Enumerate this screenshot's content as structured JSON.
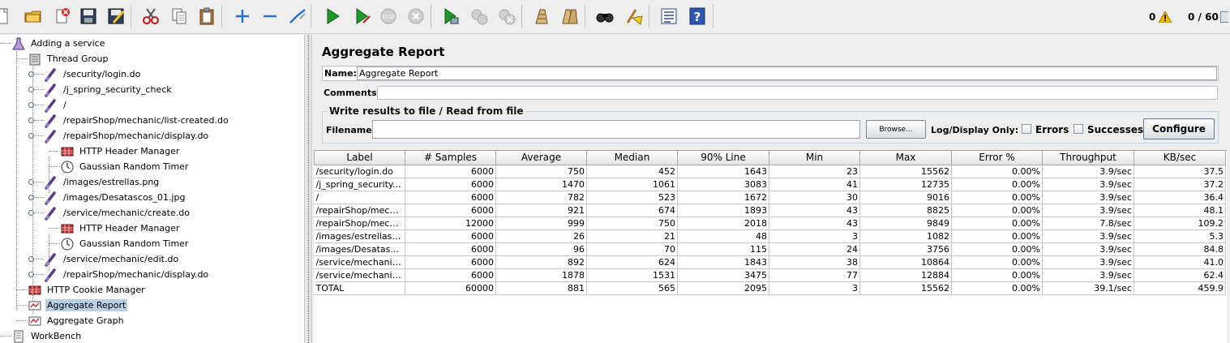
{
  "toolbar": {
    "buttons": [
      "new-icon",
      "open-icon",
      "close-icon",
      "save-icon",
      "save-as-icon",
      "cut-icon",
      "copy-icon",
      "paste-icon",
      "expand-icon",
      "collapse-icon",
      "toggle-icon",
      "start-icon",
      "start-no-pause-icon",
      "stop-icon",
      "shutdown-icon",
      "remote-start-icon",
      "remote-stop-icon",
      "remote-shutdown-icon",
      "clear-icon",
      "clear-all-icon",
      "search-icon",
      "reset-search-icon",
      "function-helper-icon",
      "help-icon"
    ],
    "error_count": "0",
    "threads": "0 / 60",
    "warning_color": "#f2b807"
  },
  "tree": {
    "items": [
      {
        "label": "Adding a service",
        "icon": "test-plan-icon"
      },
      {
        "label": "Thread Group",
        "icon": "thread-group-icon"
      },
      {
        "label": "/security/login.do",
        "icon": "http-sampler-icon"
      },
      {
        "label": "/j_spring_security_check",
        "icon": "http-sampler-icon"
      },
      {
        "label": "/",
        "icon": "http-sampler-icon"
      },
      {
        "label": "/repairShop/mechanic/list-created.do",
        "icon": "http-sampler-icon"
      },
      {
        "label": "/repairShop/mechanic/display.do",
        "icon": "http-sampler-icon"
      },
      {
        "label": "HTTP Header Manager",
        "icon": "header-manager-icon"
      },
      {
        "label": "Gaussian Random Timer",
        "icon": "timer-icon"
      },
      {
        "label": "/images/estrellas.png",
        "icon": "http-sampler-icon"
      },
      {
        "label": "/images/Desatascos_01.jpg",
        "icon": "http-sampler-icon"
      },
      {
        "label": "/service/mechanic/create.do",
        "icon": "http-sampler-icon"
      },
      {
        "label": "HTTP Header Manager",
        "icon": "header-manager-icon"
      },
      {
        "label": "Gaussian Random Timer",
        "icon": "timer-icon"
      },
      {
        "label": "/service/mechanic/edit.do",
        "icon": "http-sampler-icon"
      },
      {
        "label": "/repairShop/mechanic/display.do",
        "icon": "http-sampler-icon"
      },
      {
        "label": "HTTP Cookie Manager",
        "icon": "cookie-manager-icon"
      },
      {
        "label": "Aggregate Report",
        "icon": "listener-icon",
        "selected": true
      },
      {
        "label": "Aggregate Graph",
        "icon": "listener-icon"
      },
      {
        "label": "WorkBench",
        "icon": "workbench-icon"
      }
    ]
  },
  "panel": {
    "title": "Aggregate Report",
    "name_label": "Name:",
    "name_value": "Aggregate Report",
    "comments_label": "Comments:",
    "file_group_title": "Write results to file / Read from file",
    "filename_label": "Filename",
    "filename_value": "",
    "browse_label": "Browse...",
    "log_display_label": "Log/Display Only:",
    "errors_label": "Errors",
    "successes_label": "Successes",
    "configure_label": "Configure"
  },
  "table": {
    "columns": [
      "Label",
      "# Samples",
      "Average",
      "Median",
      "90% Line",
      "Min",
      "Max",
      "Error %",
      "Throughput",
      "KB/sec"
    ],
    "rows": [
      [
        "/security/login.do",
        "6000",
        "750",
        "452",
        "1643",
        "23",
        "15562",
        "0.00%",
        "3.9/sec",
        "37.5"
      ],
      [
        "/j_spring_security...",
        "6000",
        "1470",
        "1061",
        "3083",
        "41",
        "12735",
        "0.00%",
        "3.9/sec",
        "37.2"
      ],
      [
        "/",
        "6000",
        "782",
        "523",
        "1672",
        "30",
        "9016",
        "0.00%",
        "3.9/sec",
        "36.4"
      ],
      [
        "/repairShop/mech...",
        "6000",
        "921",
        "674",
        "1893",
        "43",
        "8825",
        "0.00%",
        "3.9/sec",
        "48.1"
      ],
      [
        "/repairShop/mech...",
        "12000",
        "999",
        "750",
        "2018",
        "43",
        "9849",
        "0.00%",
        "7.8/sec",
        "109.2"
      ],
      [
        "/images/estrellas....",
        "6000",
        "26",
        "21",
        "48",
        "3",
        "1082",
        "0.00%",
        "3.9/sec",
        "5.3"
      ],
      [
        "/images/Desatas...",
        "6000",
        "96",
        "70",
        "115",
        "24",
        "3756",
        "0.00%",
        "3.9/sec",
        "84.8"
      ],
      [
        "/service/mechanic...",
        "6000",
        "892",
        "624",
        "1843",
        "38",
        "10864",
        "0.00%",
        "3.9/sec",
        "41.0"
      ],
      [
        "/service/mechanic...",
        "6000",
        "1878",
        "1531",
        "3475",
        "77",
        "12884",
        "0.00%",
        "3.9/sec",
        "62.4"
      ],
      [
        "TOTAL",
        "60000",
        "881",
        "565",
        "2095",
        "3",
        "15562",
        "0.00%",
        "39.1/sec",
        "459.9"
      ]
    ]
  }
}
